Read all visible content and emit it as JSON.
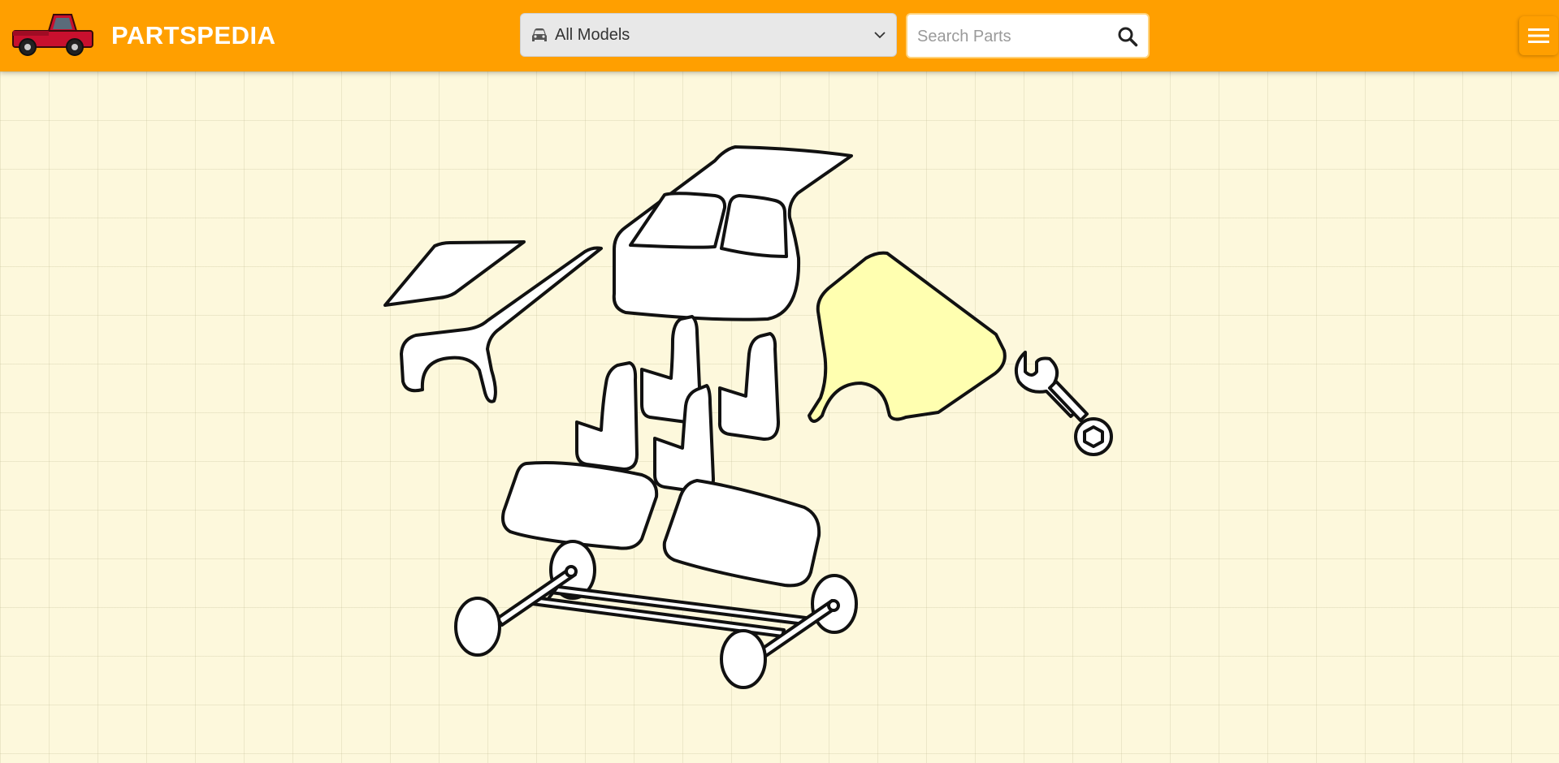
{
  "header": {
    "brand": "PARTSPEDIA",
    "logo_icon": "pickup-truck-icon",
    "accent_color": "#ff9f00",
    "model_select": {
      "value": "All Models",
      "icon": "car-icon"
    },
    "search": {
      "placeholder": "Search Parts",
      "value": "",
      "icon": "search-icon"
    },
    "menu_icon": "hamburger-menu-icon"
  },
  "diagram": {
    "type": "exploded-car-parts",
    "highlight_color": "#ffffb0",
    "highlighted_part": "rear-quarter-panel",
    "parts": [
      "hood",
      "front-fender",
      "cabin-roof",
      "door-front-left",
      "door-front-right",
      "door-rear-left",
      "door-rear-right",
      "rear-quarter-panel",
      "wrench",
      "front-seat",
      "rear-seat",
      "chassis-axles"
    ]
  }
}
